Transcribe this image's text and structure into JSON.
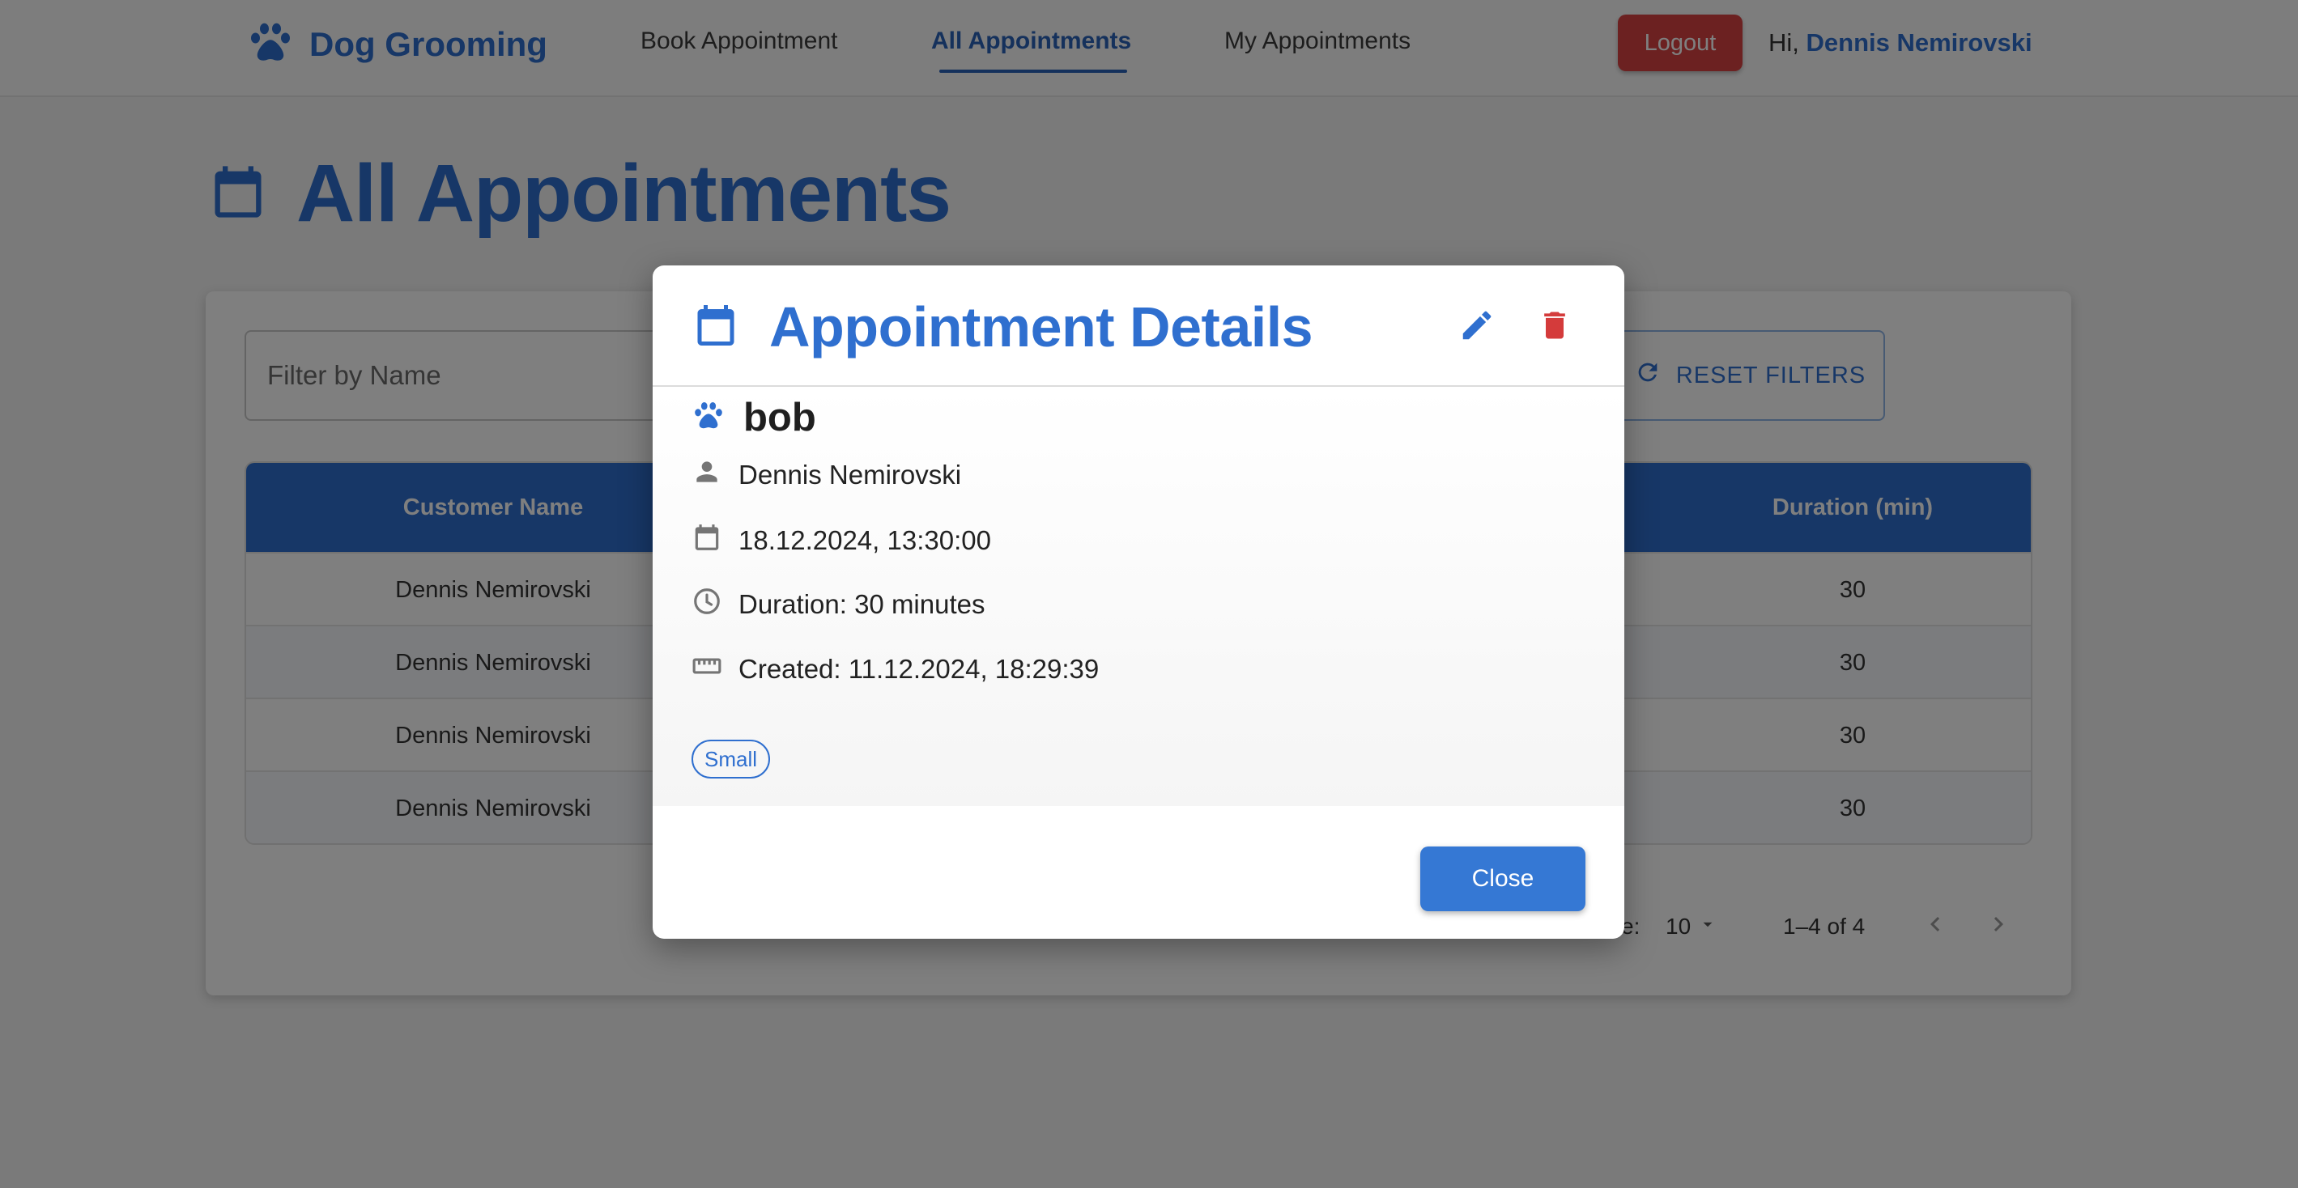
{
  "app": {
    "brand": "Dog Grooming"
  },
  "nav": {
    "links": [
      "Book Appointment",
      "All Appointments",
      "My Appointments"
    ],
    "logout_label": "Logout",
    "greeting_prefix": "Hi,",
    "user_name": "Dennis Nemirovski"
  },
  "page": {
    "title": "All Appointments"
  },
  "filters": {
    "name_placeholder": "Filter by Name",
    "reset_label": "RESET FILTERS"
  },
  "table": {
    "headers": {
      "customer": "Customer Name",
      "duration": "Duration (min)"
    },
    "rows": [
      {
        "customer": "Dennis Nemirovski",
        "duration": "30"
      },
      {
        "customer": "Dennis Nemirovski",
        "duration": "30"
      },
      {
        "customer": "Dennis Nemirovski",
        "duration": "30"
      },
      {
        "customer": "Dennis Nemirovski",
        "duration": "30"
      }
    ]
  },
  "pagination": {
    "rows_label_fragment": "e:",
    "rows_per_page": "10",
    "range": "1–4 of 4"
  },
  "dialog": {
    "title": "Appointment Details",
    "pet_name": "bob",
    "customer": "Dennis Nemirovski",
    "datetime": "18.12.2024, 13:30:00",
    "duration": "Duration: 30 minutes",
    "created": "Created: 11.12.2024, 18:29:39",
    "size_chip": "Small",
    "close_label": "Close"
  },
  "colors": {
    "primary": "#2f6fcf",
    "danger": "#d84242",
    "header_bg": "#2f6fcf"
  },
  "icons": [
    "paw-icon",
    "calendar-icon",
    "edit-icon",
    "delete-icon",
    "person-icon",
    "clock-icon",
    "ruler-icon",
    "refresh-icon",
    "dropdown-arrow-icon",
    "chevron-left-icon",
    "chevron-right-icon"
  ]
}
